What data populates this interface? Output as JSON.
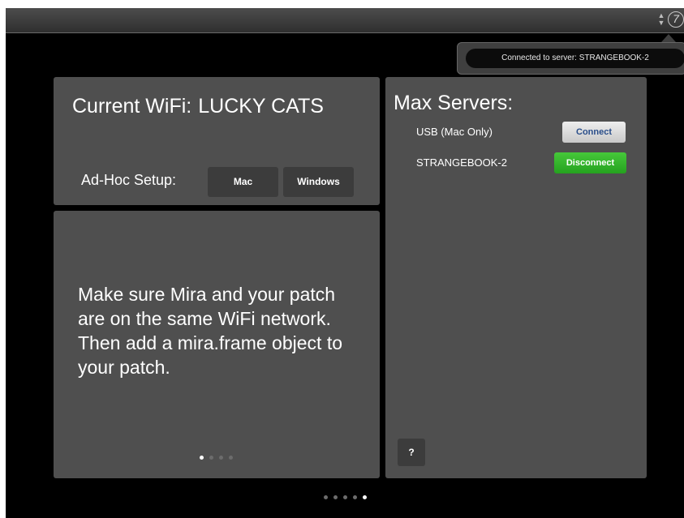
{
  "toolbar": {
    "sort_glyph": "⬍",
    "logo_glyph": "7"
  },
  "status_popover": {
    "message": "Connected to server: STRANGEBOOK-2"
  },
  "wifi_panel": {
    "label": "Current WiFi:",
    "network_name": "LUCKY CATS",
    "adhoc_label": "Ad-Hoc Setup:",
    "adhoc_mac": "Mac",
    "adhoc_windows": "Windows"
  },
  "servers_panel": {
    "title": "Max Servers:",
    "servers": [
      {
        "name": "USB (Mac Only)",
        "action": "Connect"
      },
      {
        "name": "STRANGEBOOK-2",
        "action": "Disconnect"
      }
    ],
    "help_label": "?"
  },
  "info_panel": {
    "message": "Make sure Mira and your patch are on the same WiFi network. Then add a mira.frame object to your patch.",
    "page_count": 4,
    "active_page": 1
  },
  "pager": {
    "page_count": 5,
    "active_page": 5
  },
  "colors": {
    "background": "#000000",
    "panel": "#4f4f4f",
    "button_dark": "#3c3c3c",
    "connect_text": "#2a4e8a",
    "disconnect_green": "#2fb426"
  }
}
